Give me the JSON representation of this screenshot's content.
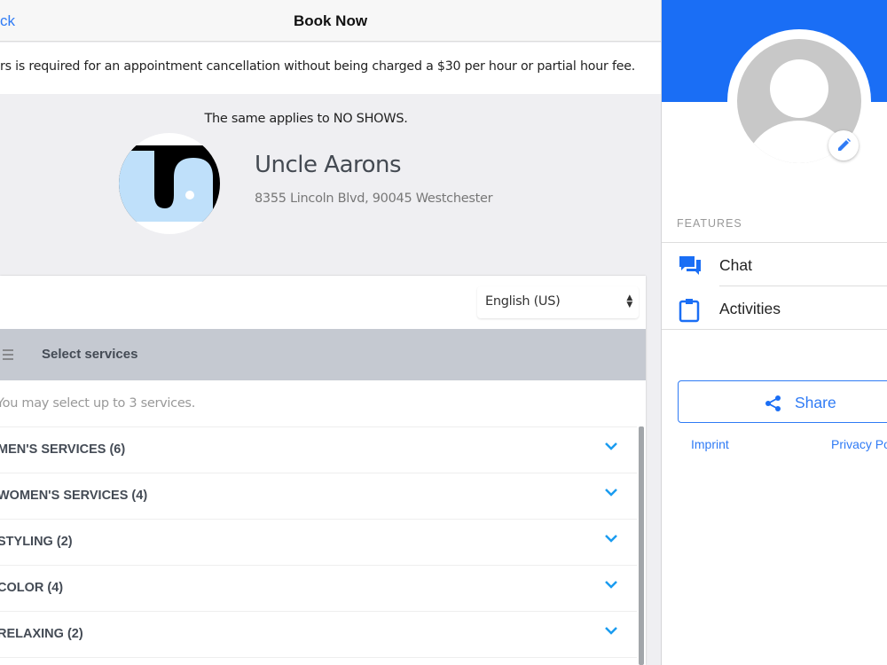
{
  "header": {
    "back_label": "ck",
    "title": "Book Now"
  },
  "notice": "rs is required for an appointment cancellation without being charged a $30 per hour or partial hour fee.",
  "no_shows": "The same applies to NO SHOWS.",
  "business": {
    "name": "Uncle Aarons",
    "address": "8355 Lincoln Blvd, 90045 Westchester"
  },
  "language": {
    "selected": "English (US)"
  },
  "services": {
    "title": "Select services",
    "hint": "You may select up to 3 services.",
    "categories": [
      {
        "label": "MEN'S SERVICES (6)"
      },
      {
        "label": "WOMEN'S SERVICES (4)"
      },
      {
        "label": "STYLING (2)"
      },
      {
        "label": "COLOR (4)"
      },
      {
        "label": "RELAXING (2)"
      }
    ]
  },
  "sidebar": {
    "features_label": "FEATURES",
    "items": [
      {
        "label": "Chat",
        "icon": "chat-icon"
      },
      {
        "label": "Activities",
        "icon": "clipboard-icon"
      }
    ],
    "share_label": "Share",
    "links": {
      "imprint": "Imprint",
      "privacy": "Privacy Po"
    }
  },
  "colors": {
    "accent": "#2f7bf5",
    "banner": "#1a6ef5"
  }
}
